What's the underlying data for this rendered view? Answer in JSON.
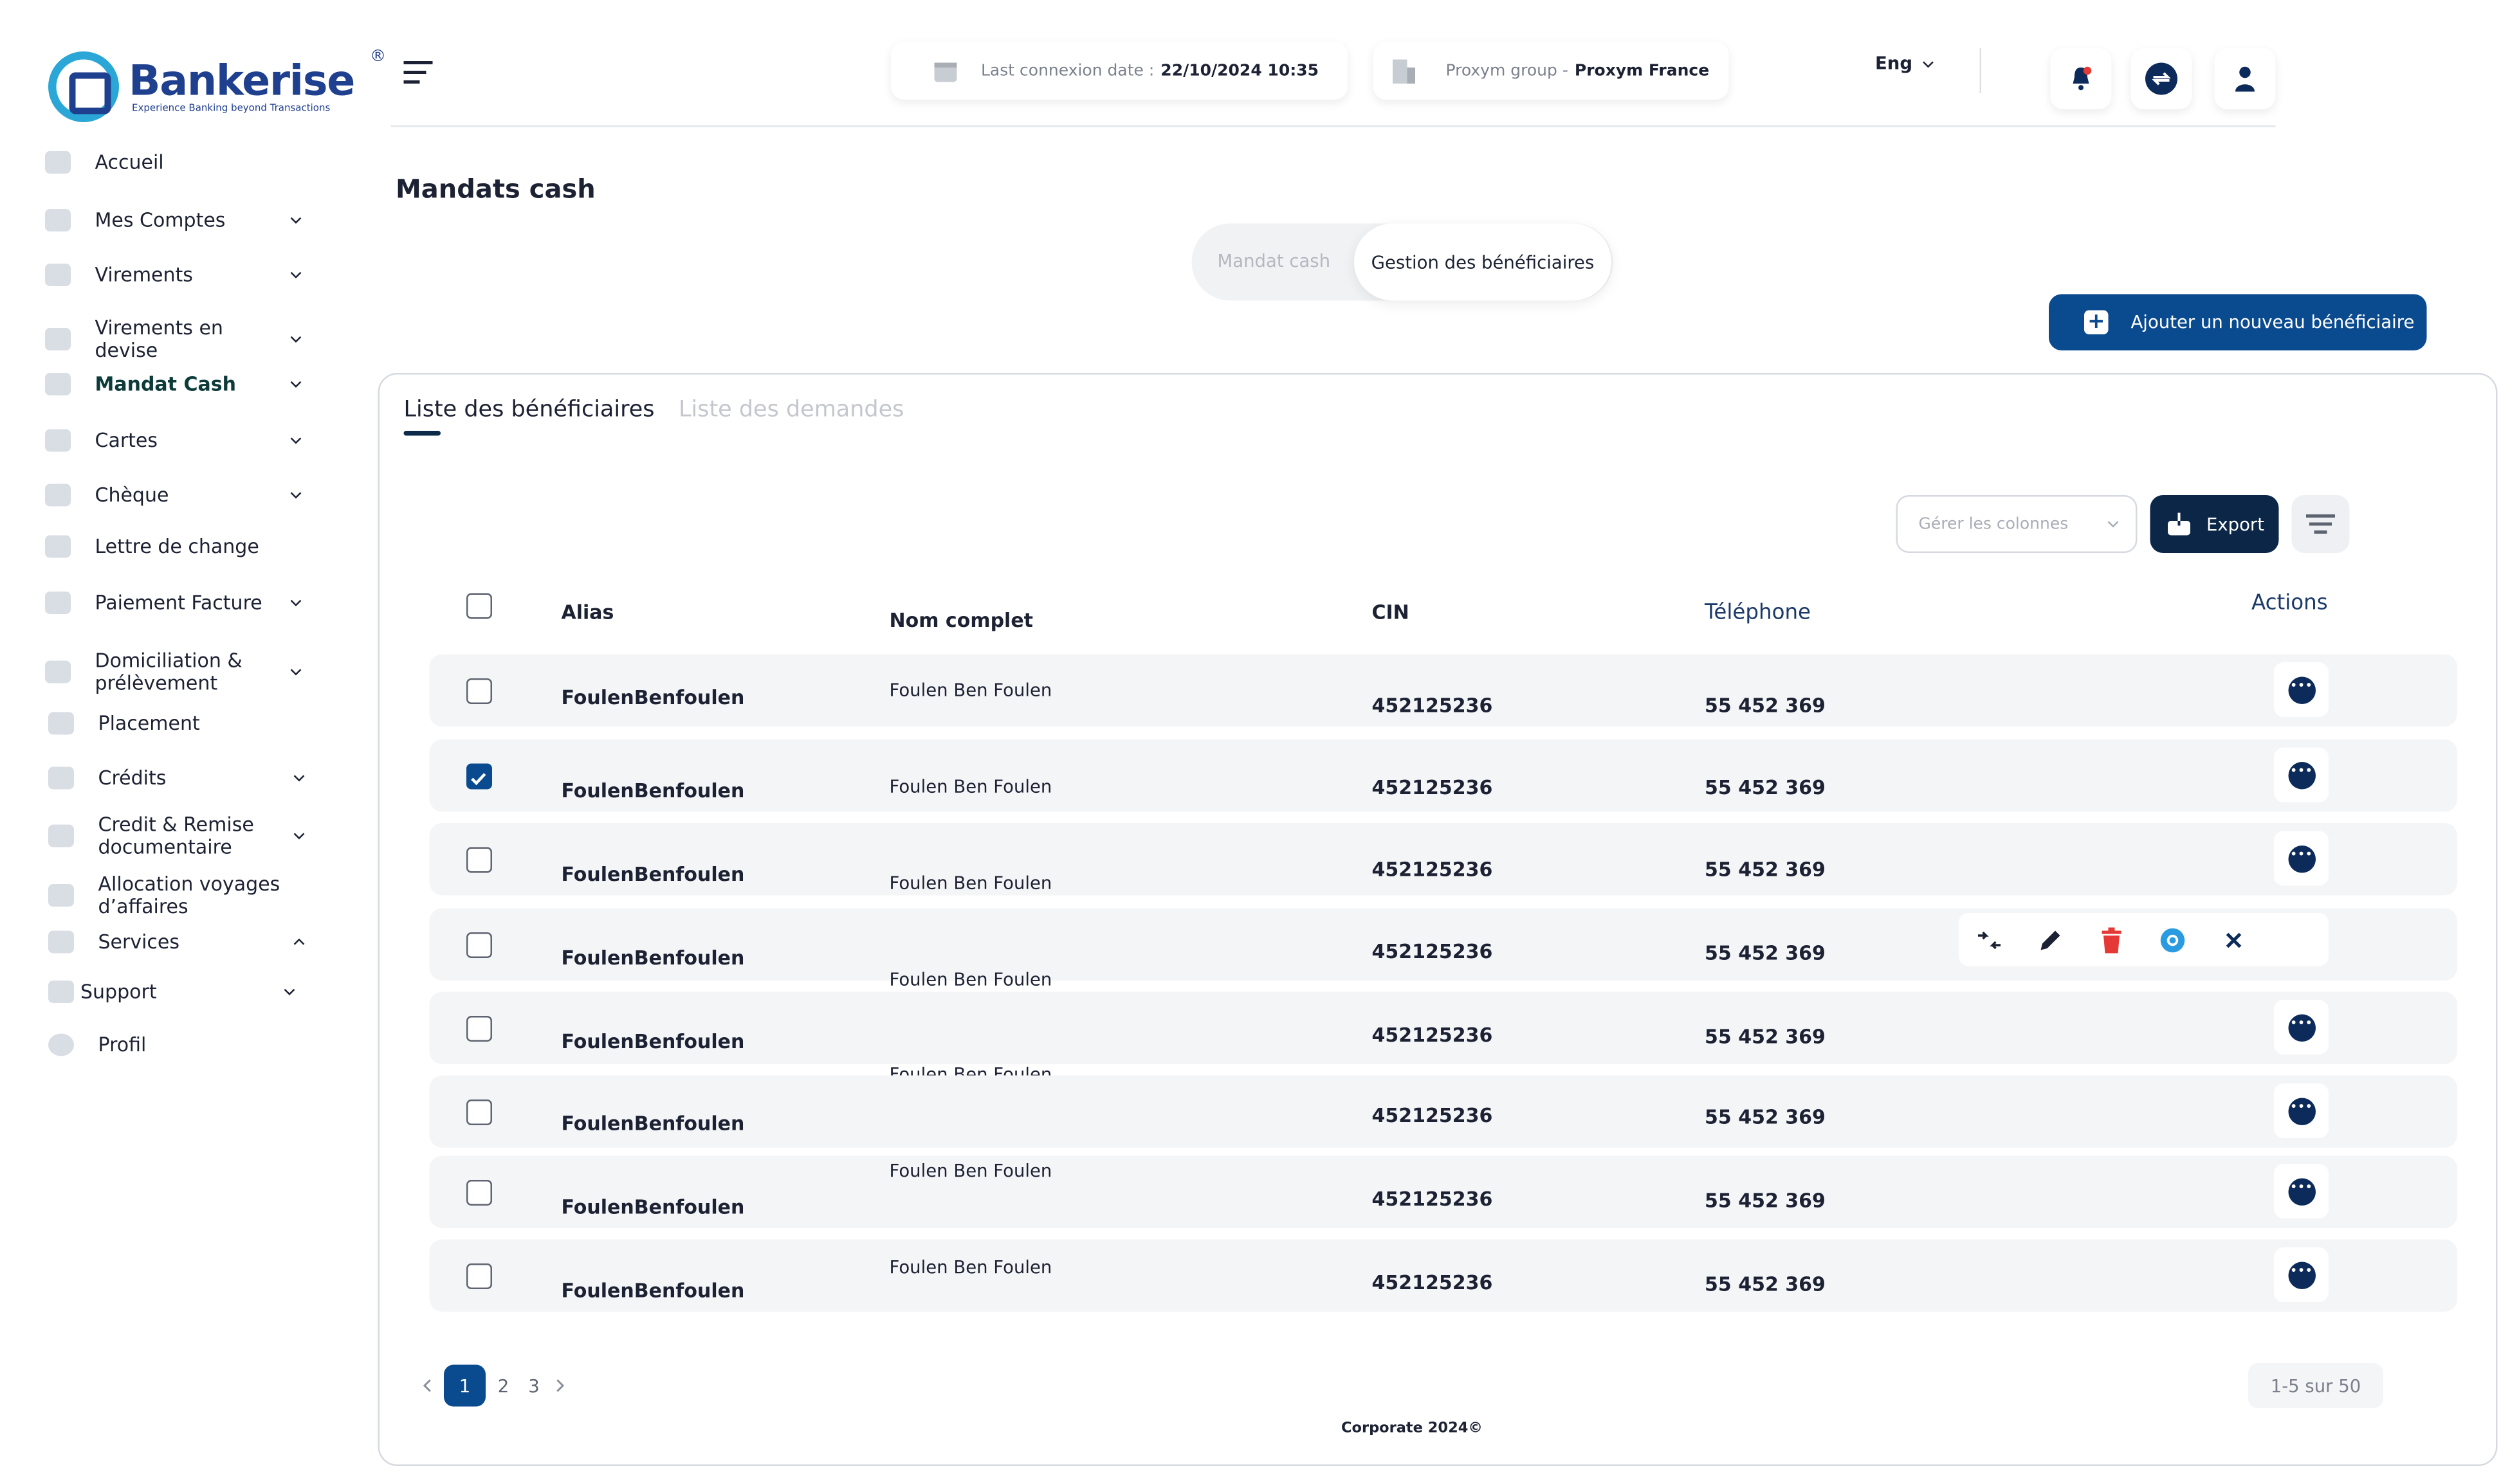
{
  "brand": {
    "name": "Bankerise",
    "tagline": "Experience Banking beyond Transactions",
    "reg": "®"
  },
  "sidebar": {
    "items": [
      {
        "label": "Accueil"
      },
      {
        "label": "Mes Comptes"
      },
      {
        "label": "Virements"
      },
      {
        "label": "Virements en devise"
      },
      {
        "label": "Mandat Cash"
      },
      {
        "label": "Cartes"
      },
      {
        "label": "Chèque"
      },
      {
        "label": "Lettre de change"
      },
      {
        "label": "Paiement Facture"
      },
      {
        "label": "Domiciliation & prélèvement"
      },
      {
        "label": "Placement"
      },
      {
        "label": "Crédits"
      },
      {
        "label": "Credit & Remise documentaire"
      },
      {
        "label": "Allocation  voyages d’affaires"
      },
      {
        "label": "Services"
      },
      {
        "label": "Support"
      },
      {
        "label": "Profil"
      }
    ]
  },
  "header": {
    "last_conn_label": "Last connexion date :",
    "last_conn_value": "22/10/2024 10:35",
    "group_label": "Proxym group -",
    "group_value": "Proxym France",
    "lang": "Eng"
  },
  "page": {
    "title": "Mandats cash",
    "seg_inactive": "Mandat cash",
    "seg_active": "Gestion des bénéficiaires",
    "add_button": "Ajouter un nouveau bénéficiaire"
  },
  "panel": {
    "tab_active": "Liste des bénéficiaires",
    "tab_inactive": "Liste des demandes",
    "columns_placeholder": "Gérer les colonnes",
    "export": "Export"
  },
  "table": {
    "headers": {
      "alias": "Alias",
      "nom": "Nom complet",
      "cin": "CIN",
      "tel": "Téléphone",
      "actions": "Actions"
    },
    "rows": [
      {
        "alias": "FoulenBenfoulen",
        "nom": "Foulen Ben Foulen",
        "cin": "452125236",
        "tel": "55 452 369",
        "checked": false
      },
      {
        "alias": "FoulenBenfoulen",
        "nom": "Foulen Ben Foulen",
        "cin": "452125236",
        "tel": "55 452 369",
        "checked": true
      },
      {
        "alias": "FoulenBenfoulen",
        "nom": "Foulen Ben Foulen",
        "cin": "452125236",
        "tel": "55 452 369",
        "checked": false
      },
      {
        "alias": "FoulenBenfoulen",
        "nom": "Foulen Ben Foulen",
        "cin": "452125236",
        "tel": "55 452 369",
        "checked": false
      },
      {
        "alias": "FoulenBenfoulen",
        "nom": "Foulen Ben Foulen",
        "cin": "452125236",
        "tel": "55 452 369",
        "checked": false
      },
      {
        "alias": "FoulenBenfoulen",
        "nom": "Foulen Ben Foulen",
        "cin": "452125236",
        "tel": "55 452 369",
        "checked": false
      },
      {
        "alias": "FoulenBenfoulen",
        "nom": "Foulen Ben Foulen",
        "cin": "452125236",
        "tel": "55 452 369",
        "checked": false
      },
      {
        "alias": "FoulenBenfoulen",
        "nom": "Foulen Ben Foulen",
        "cin": "452125236",
        "tel": "55 452 369",
        "checked": false
      }
    ]
  },
  "pagination": {
    "pages": [
      "1",
      "2",
      "3"
    ],
    "current": "1",
    "count": "1-5 sur 50"
  },
  "footer": "Corporate 2024©",
  "colors": {
    "primary": "#0a4a8f",
    "dark": "#0c2647",
    "danger": "#e53935",
    "accent": "#2aa7d6"
  }
}
